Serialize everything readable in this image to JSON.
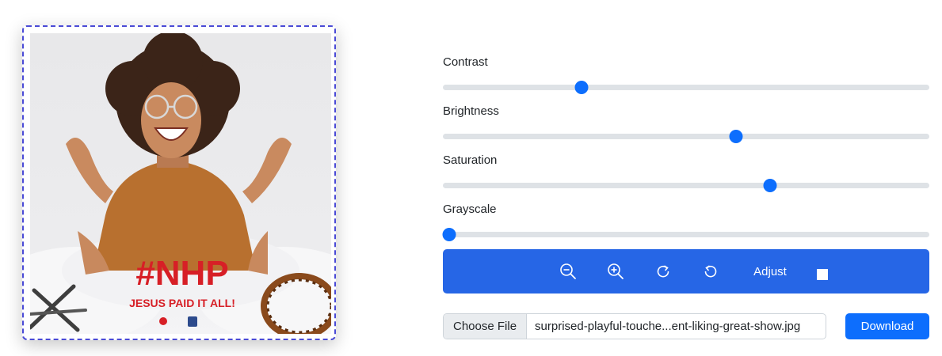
{
  "preview": {
    "logo_text": "#NHP",
    "tagline": "JESUS PAID IT ALL!"
  },
  "sliders": [
    {
      "label": "Contrast",
      "value": 0.285
    },
    {
      "label": "Brightness",
      "value": 0.603
    },
    {
      "label": "Saturation",
      "value": 0.672
    },
    {
      "label": "Grayscale",
      "value": 0.013
    }
  ],
  "toolbar": {
    "zoom_out_icon": "zoom-out-icon",
    "zoom_in_icon": "zoom-in-icon",
    "rotate_right_icon": "rotate-right-icon",
    "rotate_left_icon": "rotate-left-icon",
    "adjust_label": "Adjust",
    "color": "#2666e6"
  },
  "file_input": {
    "button_label": "Choose File",
    "file_name": "surprised-playful-touche...ent-liking-great-show.jpg"
  },
  "download_label": "Download",
  "colors": {
    "accent": "#0d6efd",
    "frame_border": "#4a4ad6",
    "logo_red": "#d71f26"
  }
}
